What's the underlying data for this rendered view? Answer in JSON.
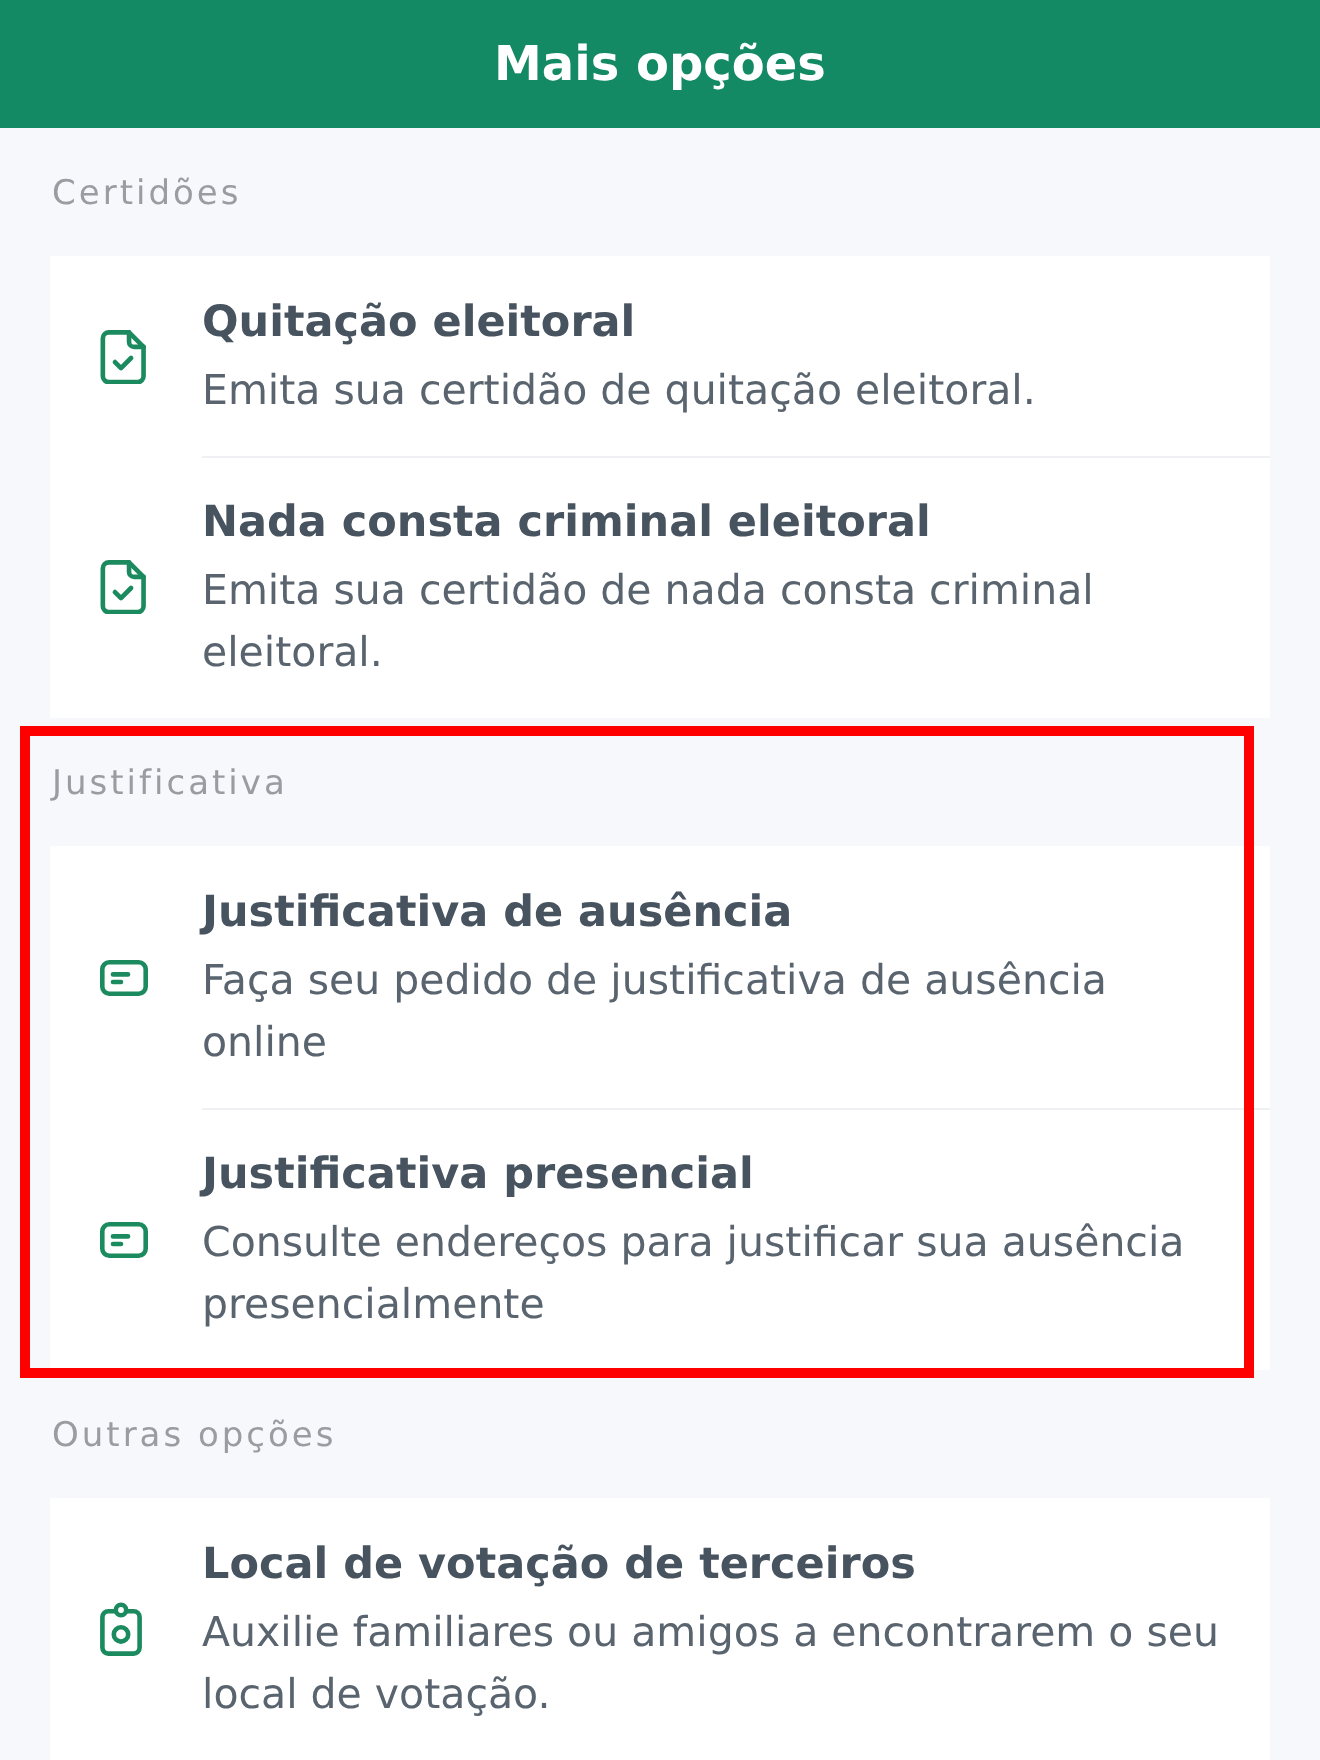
{
  "header": {
    "title": "Mais opções"
  },
  "sections": [
    {
      "label": "Certidões",
      "highlighted": false,
      "items": [
        {
          "kind": "certificate",
          "title": "Quitação eleitoral",
          "description": "Emita sua certidão de quitação eleitoral."
        },
        {
          "kind": "certificate",
          "title": "Nada consta criminal eleitoral",
          "description": "Emita sua certidão de nada consta criminal eleitoral."
        }
      ]
    },
    {
      "label": "Justificativa",
      "highlighted": true,
      "items": [
        {
          "kind": "justification",
          "title": "Justificativa de ausência",
          "description": "Faça seu pedido de justificativa de ausência online"
        },
        {
          "kind": "justification",
          "title": "Justificativa presencial",
          "description": "Consulte endereços para justificar sua ausência presencialmente"
        }
      ]
    },
    {
      "label": "Outras opções",
      "highlighted": false,
      "items": [
        {
          "kind": "polling",
          "title": "Local de votação de terceiros",
          "description": "Auxilie familiares ou amigos a encontrarem o seu local de votação."
        }
      ]
    }
  ]
}
